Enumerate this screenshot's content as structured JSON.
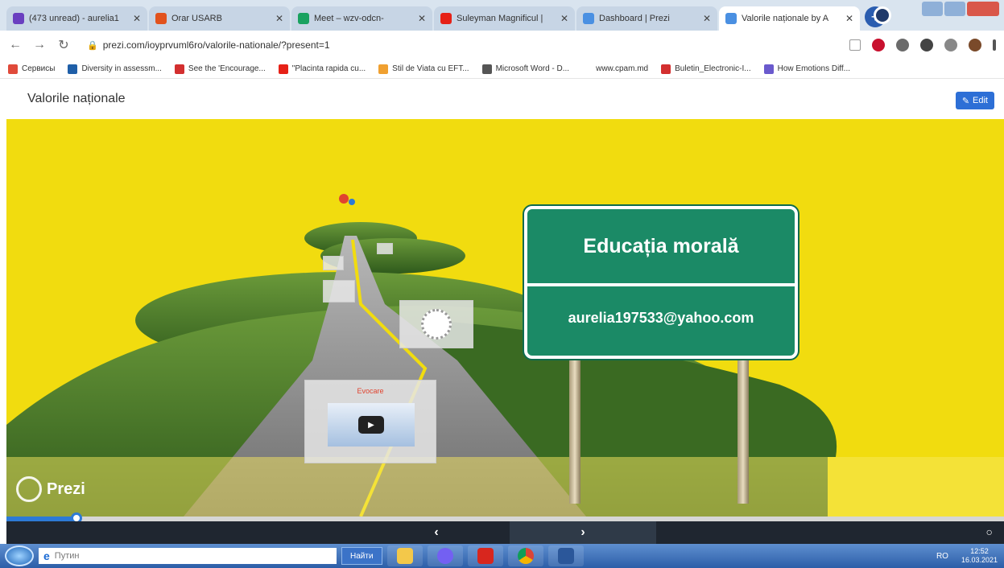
{
  "browser": {
    "tabs": [
      {
        "title": "(473 unread) - aurelia1",
        "color": "#6a3fc0",
        "active": false
      },
      {
        "title": "Orar USARB",
        "color": "#e2521d",
        "active": false
      },
      {
        "title": "Meet – wzv-odcn-",
        "color": "#1aa260",
        "active": false
      },
      {
        "title": "Suleyman Magnificul |",
        "color": "#e62117",
        "active": false
      },
      {
        "title": "Dashboard | Prezi",
        "color": "#4a90e2",
        "active": false
      },
      {
        "title": "Valorile naționale by A",
        "color": "#4a90e2",
        "active": true
      }
    ],
    "new_tab": "+",
    "url": "prezi.com/ioyprvuml6ro/valorile-nationale/?present=1",
    "bookmarks": [
      {
        "label": "Сервисы",
        "color": "#e04a3a"
      },
      {
        "label": "Diversity in assessm...",
        "color": "#1f5fa8"
      },
      {
        "label": "See the 'Encourage...",
        "color": "#d32f2f"
      },
      {
        "label": "\"Placinta rapida cu...",
        "color": "#e62117"
      },
      {
        "label": "Stil de Viata cu EFT...",
        "color": "#f0a030"
      },
      {
        "label": "Microsoft Word - D...",
        "color": "#555555"
      },
      {
        "label": "www.cpam.md",
        "color": "#ffffff"
      },
      {
        "label": "Buletin_Electronic-I...",
        "color": "#d32f2f"
      },
      {
        "label": "How Emotions Diff...",
        "color": "#6a5acd"
      }
    ]
  },
  "prezi": {
    "title": "Valorile naționale",
    "edit_label": "Edit",
    "sign_top": "Educația morală",
    "sign_bottom": "aurelia197533@yahoo.com",
    "frame_caption": "Evocare",
    "logo": "Prezi",
    "progress": 0.07,
    "prev": "‹",
    "next": "›",
    "accent": "#f1dc0f",
    "sign_color": "#1b8a66"
  },
  "taskbar": {
    "search_placeholder": "Путин",
    "find_button": "Найти",
    "language": "RO",
    "time": "12:52",
    "date": "16.03.2021"
  }
}
